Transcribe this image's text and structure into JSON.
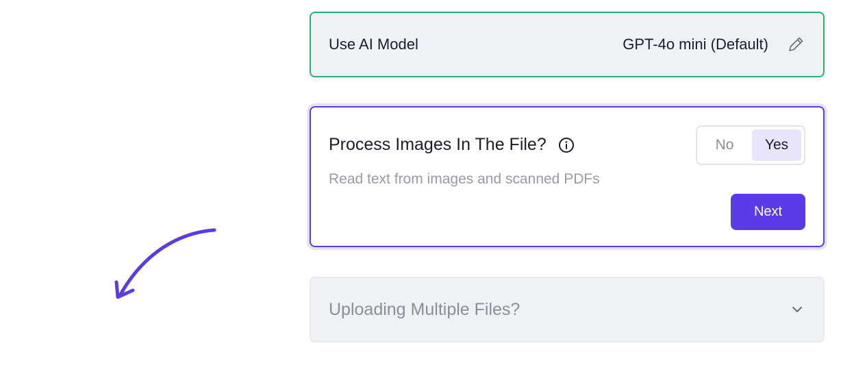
{
  "model": {
    "label": "Use AI Model",
    "value": "GPT-4o mini (Default)",
    "edit_icon": "pencil-icon"
  },
  "process_images": {
    "title": "Process Images In The File?",
    "info_icon": "info-icon",
    "description": "Read text from images and scanned PDFs",
    "toggle": {
      "options": [
        "No",
        "Yes"
      ],
      "selected": "Yes"
    },
    "next_label": "Next"
  },
  "upload": {
    "title": "Uploading Multiple Files?",
    "chevron_icon": "chevron-down-icon"
  },
  "colors": {
    "accent": "#5b3be8",
    "success_border": "#2bb06e",
    "card_bg": "#f0f1f5",
    "selected_bg": "#e8e5fb"
  },
  "decor": {
    "arrow_icon": "curved-arrow-icon"
  }
}
